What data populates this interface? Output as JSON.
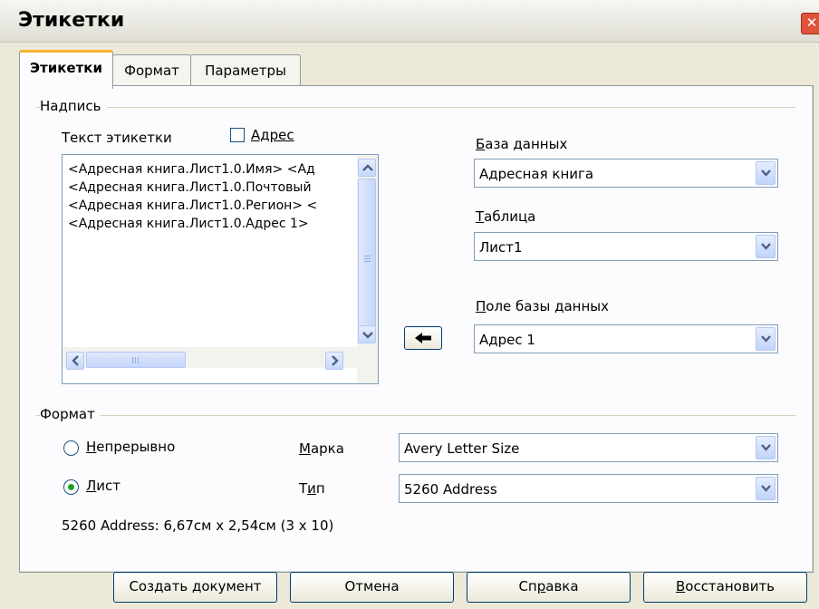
{
  "window": {
    "title": "Этикетки",
    "close_icon": "close-icon"
  },
  "tabs": [
    {
      "label": "Этикетки",
      "active": true
    },
    {
      "label": "Формат",
      "active": false
    },
    {
      "label": "Параметры",
      "active": false
    }
  ],
  "inscription": {
    "group_label": "Надпись",
    "label_text_label": "Текст этикетки",
    "address_checkbox": {
      "label": "Адрес",
      "checked": false
    },
    "lines": [
      "<Адресная книга.Лист1.0.Имя> <Ад",
      "<Адресная книга.Лист1.0.Почтовый",
      "<Адресная книга.Лист1.0.Регион> <",
      "<Адресная книга.Лист1.0.Адрес 1>"
    ],
    "database_label": "База данных",
    "database_value": "Адресная книга",
    "table_label": "Таблица",
    "table_value": "Лист1",
    "field_label": "Поле базы данных",
    "field_value": "Адрес 1",
    "insert_icon": "arrow-left-icon"
  },
  "format": {
    "group_label": "Формат",
    "continuous_label": "Непрерывно",
    "sheet_label": "Лист",
    "selected": "sheet",
    "brand_label": "Марка",
    "brand_value": "Avery Letter Size",
    "type_label": "Тип",
    "type_value": "5260 Address",
    "info": "5260 Address: 6,67см x 2,54см (3 x 10)"
  },
  "buttons": {
    "create": "Создать документ",
    "cancel": "Отмена",
    "help": "Справка",
    "reset": "Восстановить"
  }
}
